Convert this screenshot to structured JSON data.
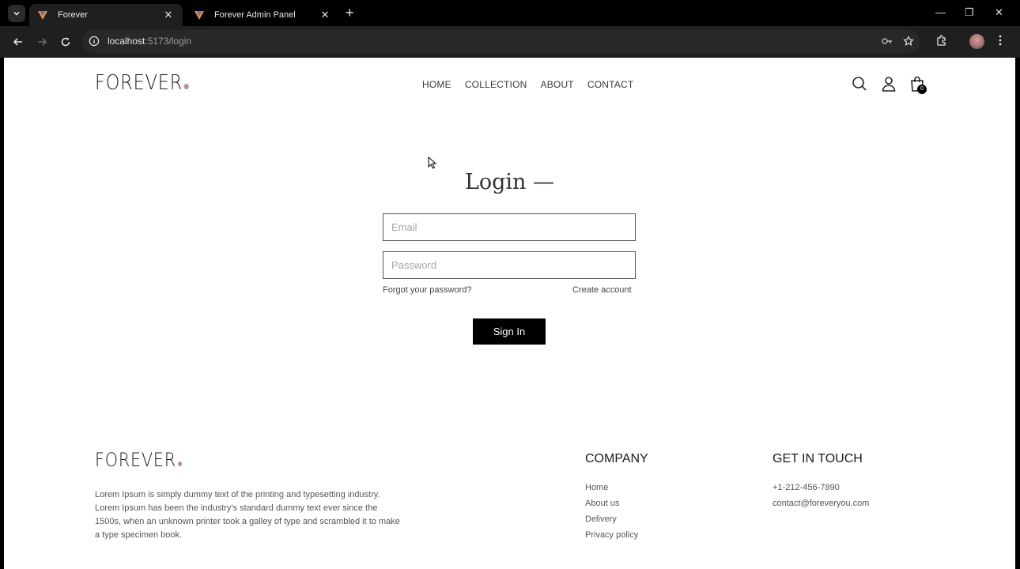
{
  "browser": {
    "tabs": [
      {
        "title": "Forever",
        "active": true
      },
      {
        "title": "Forever Admin Panel",
        "active": false
      }
    ],
    "url_host": "localhost",
    "url_path": ":5173/login"
  },
  "header": {
    "logo": "FOREVER",
    "nav": [
      "HOME",
      "COLLECTION",
      "ABOUT",
      "CONTACT"
    ],
    "cart_count": "0"
  },
  "login": {
    "title": "Login —",
    "email_placeholder": "Email",
    "password_placeholder": "Password",
    "forgot_password": "Forgot your password?",
    "create_account": "Create account",
    "sign_in": "Sign In"
  },
  "footer": {
    "logo": "FOREVER",
    "description": "Lorem Ipsum is simply dummy text of the printing and typesetting industry. Lorem Ipsum has been the industry's standard dummy text ever since the 1500s, when an unknown printer took a galley of type and scrambled it to make a type specimen book.",
    "company_title": "COMPANY",
    "company_links": [
      "Home",
      "About us",
      "Delivery",
      "Privacy policy"
    ],
    "touch_title": "GET IN TOUCH",
    "phone": "+1-212-456-7890",
    "email": "contact@foreveryou.com"
  },
  "colors": {
    "accent_dot": "#c586a5",
    "button_bg": "#000000"
  }
}
